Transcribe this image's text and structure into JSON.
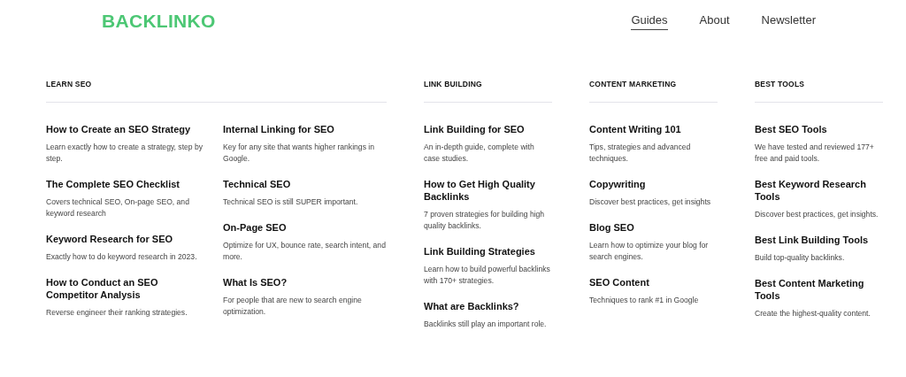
{
  "logo": "BACKLINKO",
  "nav": [
    {
      "label": "Guides",
      "selected": true
    },
    {
      "label": "About",
      "selected": false
    },
    {
      "label": "Newsletter",
      "selected": false
    }
  ],
  "sections": [
    {
      "title": "LEARN SEO",
      "columns": [
        [
          {
            "title": "How to Create an SEO Strategy",
            "description": "Learn exactly how to create a strategy, step by step."
          },
          {
            "title": "The Complete SEO Checklist",
            "description": "Covers technical SEO, On-page SEO, and keyword research"
          },
          {
            "title": "Keyword Research for SEO",
            "description": "Exactly how to do keyword research in 2023."
          },
          {
            "title": "How to Conduct an SEO Competitor Analysis",
            "description": "Reverse engineer their ranking strategies."
          }
        ],
        [
          {
            "title": "Internal Linking for SEO",
            "description": "Key for any site that wants higher rankings in Google."
          },
          {
            "title": "Technical SEO",
            "description": "Technical SEO is still SUPER important."
          },
          {
            "title": "On-Page SEO",
            "description": "Optimize for UX, bounce rate, search intent, and more."
          },
          {
            "title": "What Is SEO?",
            "description": "For people that are new to search engine optimization."
          }
        ]
      ]
    },
    {
      "title": "LINK BUILDING",
      "columns": [
        [
          {
            "title": "Link Building for SEO",
            "description": "An in-depth guide, complete with case studies."
          },
          {
            "title": "How to Get High Quality Backlinks",
            "description": "7 proven strategies for building high quality backlinks."
          },
          {
            "title": "Link Building Strategies",
            "description": "Learn how to build powerful backlinks with 170+ strategies."
          },
          {
            "title": "What are Backlinks?",
            "description": "Backlinks still play an important role."
          }
        ]
      ]
    },
    {
      "title": "CONTENT MARKETING",
      "columns": [
        [
          {
            "title": "Content Writing 101",
            "description": "Tips, strategies and advanced techniques."
          },
          {
            "title": "Copywriting",
            "description": "Discover best practices, get insights"
          },
          {
            "title": "Blog SEO",
            "description": "Learn how to optimize your blog for search engines."
          },
          {
            "title": "SEO Content",
            "description": "Techniques to rank #1 in Google"
          }
        ]
      ]
    },
    {
      "title": "BEST TOOLS",
      "columns": [
        [
          {
            "title": "Best SEO Tools",
            "description": "We have tested and reviewed 177+ free and paid tools."
          },
          {
            "title": "Best Keyword Research Tools",
            "description": "Discover best practices, get insights."
          },
          {
            "title": "Best Link Building Tools",
            "description": "Build top-quality backlinks."
          },
          {
            "title": "Best Content Marketing Tools",
            "description": "Create the highest-quality content."
          }
        ]
      ]
    }
  ]
}
